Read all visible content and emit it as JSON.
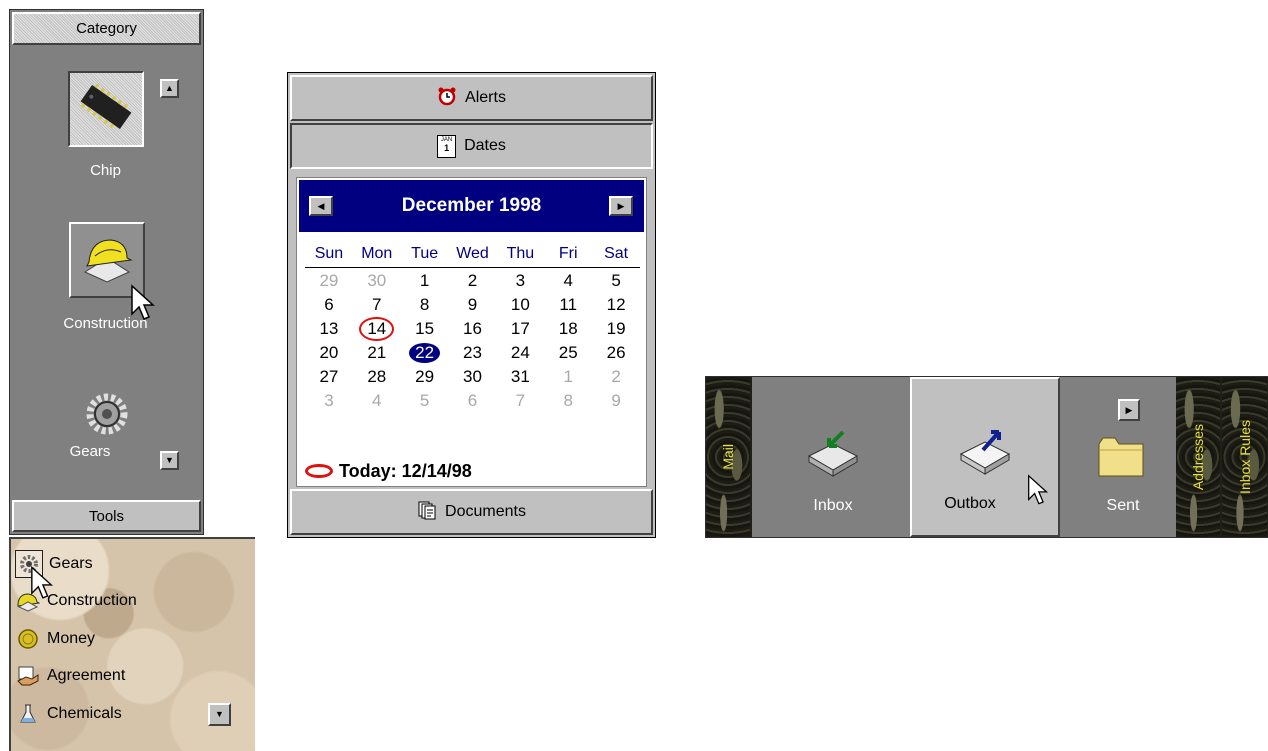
{
  "category_bar": {
    "header": "Category",
    "footer": "Tools",
    "items": [
      {
        "label": "Chip",
        "icon": "chip-icon"
      },
      {
        "label": "Construction",
        "icon": "hardhat-icon"
      },
      {
        "label": "Gears",
        "icon": "gears-icon"
      }
    ]
  },
  "calendar_panel": {
    "tabs": {
      "alerts": "Alerts",
      "dates": "Dates",
      "documents": "Documents"
    },
    "date_icon_text": {
      "month": "JAN",
      "day": "1"
    },
    "month_title": "December 1998",
    "weekdays": [
      "Sun",
      "Mon",
      "Tue",
      "Wed",
      "Thu",
      "Fri",
      "Sat"
    ],
    "days": [
      {
        "d": "29",
        "o": true
      },
      {
        "d": "30",
        "o": true
      },
      {
        "d": "1"
      },
      {
        "d": "2"
      },
      {
        "d": "3"
      },
      {
        "d": "4"
      },
      {
        "d": "5"
      },
      {
        "d": "6"
      },
      {
        "d": "7"
      },
      {
        "d": "8"
      },
      {
        "d": "9"
      },
      {
        "d": "10"
      },
      {
        "d": "11"
      },
      {
        "d": "12"
      },
      {
        "d": "13"
      },
      {
        "d": "14",
        "today": true
      },
      {
        "d": "15"
      },
      {
        "d": "16"
      },
      {
        "d": "17"
      },
      {
        "d": "18"
      },
      {
        "d": "19"
      },
      {
        "d": "20"
      },
      {
        "d": "21"
      },
      {
        "d": "22",
        "selected": true
      },
      {
        "d": "23"
      },
      {
        "d": "24"
      },
      {
        "d": "25"
      },
      {
        "d": "26"
      },
      {
        "d": "27"
      },
      {
        "d": "28"
      },
      {
        "d": "29"
      },
      {
        "d": "30"
      },
      {
        "d": "31"
      },
      {
        "d": "1",
        "o": true
      },
      {
        "d": "2",
        "o": true
      },
      {
        "d": "3",
        "o": true
      },
      {
        "d": "4",
        "o": true
      },
      {
        "d": "5",
        "o": true
      },
      {
        "d": "6",
        "o": true
      },
      {
        "d": "7",
        "o": true
      },
      {
        "d": "8",
        "o": true
      },
      {
        "d": "9",
        "o": true
      }
    ],
    "today_label": "Today: 12/14/98"
  },
  "mail_bar": {
    "left_label": "Mail",
    "items": [
      {
        "label": "Inbox",
        "icon": "inbox-tray-icon"
      },
      {
        "label": "Outbox",
        "icon": "outbox-tray-icon"
      },
      {
        "label": "Sent",
        "icon": "folder-icon"
      }
    ],
    "right_labels": [
      "Addresses",
      "Inbox Rules"
    ]
  },
  "tools_list": {
    "items": [
      {
        "label": "Gears",
        "icon": "gears-icon"
      },
      {
        "label": "Construction",
        "icon": "hardhat-icon"
      },
      {
        "label": "Money",
        "icon": "coin-icon"
      },
      {
        "label": "Agreement",
        "icon": "handshake-icon"
      },
      {
        "label": "Chemicals",
        "icon": "flask-icon"
      }
    ]
  },
  "colors": {
    "calendar_header": "#000080",
    "today_circle": "#e01010",
    "mail_side_label": "#e8e040",
    "panel_gray": "#808080"
  }
}
